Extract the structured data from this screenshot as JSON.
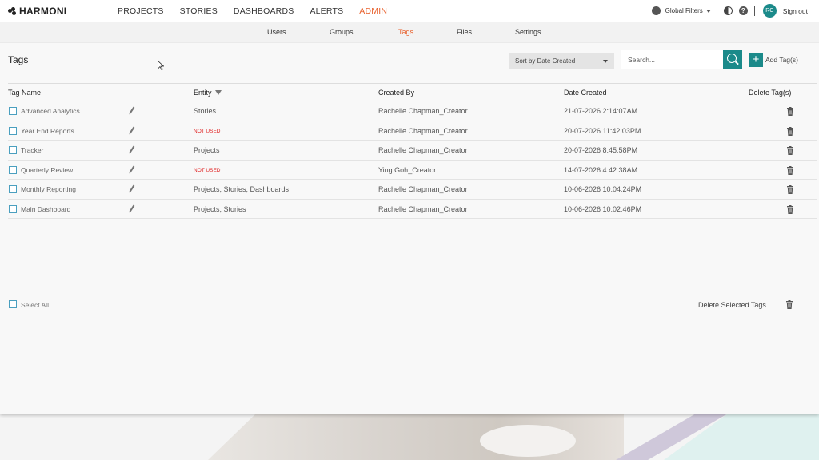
{
  "app": {
    "logo_text": "HARMONI"
  },
  "topnav": {
    "items": [
      {
        "label": "PROJECTS",
        "active": false
      },
      {
        "label": "STORIES",
        "active": false
      },
      {
        "label": "DASHBOARDS",
        "active": false
      },
      {
        "label": "ALERTS",
        "active": false
      },
      {
        "label": "ADMIN",
        "active": true
      }
    ],
    "global_filters_label": "Global Filters",
    "avatar_initials": "RC",
    "signout_label": "Sign out",
    "help_glyph": "?"
  },
  "subnav": {
    "items": [
      {
        "label": "Users",
        "active": false
      },
      {
        "label": "Groups",
        "active": false
      },
      {
        "label": "Tags",
        "active": true
      },
      {
        "label": "Files",
        "active": false
      },
      {
        "label": "Settings",
        "active": false
      }
    ]
  },
  "page": {
    "title": "Tags",
    "sort_label": "Sort by Date Created",
    "search_placeholder": "Search...",
    "add_label": "Add Tag(s)",
    "add_glyph": "+"
  },
  "table": {
    "headers": {
      "tag_name": "Tag Name",
      "entity": "Entity",
      "created_by": "Created By",
      "date_created": "Date Created",
      "delete": "Delete Tag(s)"
    },
    "rows": [
      {
        "tag_name": "Advanced Analytics",
        "entity": "Stories",
        "not_used": false,
        "created_by": "Rachelle Chapman_Creator",
        "date_created": "21-07-2026 2:14:07AM"
      },
      {
        "tag_name": "Year End Reports",
        "entity": "NOT USED",
        "not_used": true,
        "created_by": "Rachelle Chapman_Creator",
        "date_created": "20-07-2026 11:42:03PM"
      },
      {
        "tag_name": "Tracker",
        "entity": "Projects",
        "not_used": false,
        "created_by": "Rachelle Chapman_Creator",
        "date_created": "20-07-2026 8:45:58PM"
      },
      {
        "tag_name": "Quarterly Review",
        "entity": "NOT USED",
        "not_used": true,
        "created_by": "Ying Goh_Creator",
        "date_created": "14-07-2026 4:42:38AM"
      },
      {
        "tag_name": "Monthly Reporting",
        "entity": "Projects, Stories, Dashboards",
        "not_used": false,
        "created_by": "Rachelle Chapman_Creator",
        "date_created": "10-06-2026 10:04:24PM"
      },
      {
        "tag_name": "Main Dashboard",
        "entity": "Projects, Stories",
        "not_used": false,
        "created_by": "Rachelle Chapman_Creator",
        "date_created": "10-06-2026 10:02:46PM"
      }
    ]
  },
  "footer": {
    "select_all_label": "Select All",
    "delete_selected_label": "Delete Selected Tags"
  },
  "colors": {
    "accent": "#e8602c",
    "teal": "#1b8a8a",
    "not_used": "#e02020"
  },
  "icons": [
    "globe-icon",
    "contrast-icon",
    "help-icon",
    "search-icon",
    "plus-icon",
    "filter-icon",
    "pencil-icon",
    "trash-icon"
  ]
}
